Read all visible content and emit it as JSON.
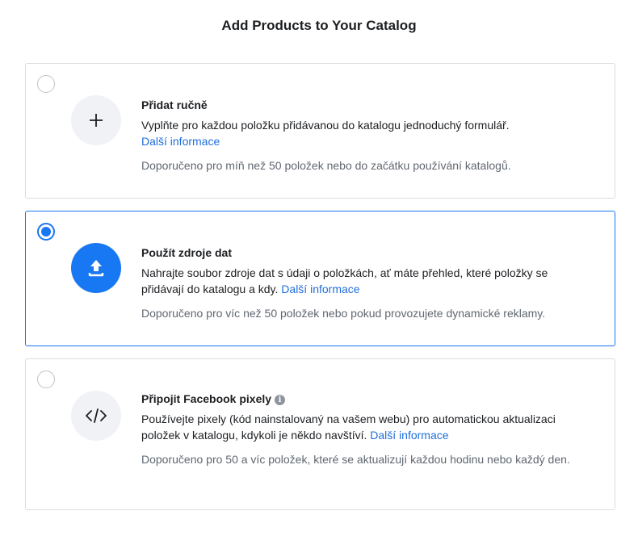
{
  "page": {
    "title": "Add Products to Your Catalog"
  },
  "colors": {
    "accent": "#1877f2",
    "link": "#216fdb",
    "muted": "#606770",
    "border": "#dadde1"
  },
  "options": [
    {
      "title": "Přidat ručně",
      "description": "Vyplňte pro každou položku přidávanou do katalogu jednoduchý formulář.",
      "link": "Další informace",
      "note": "Doporučeno pro míň než 50 položek nebo do začátku používání katalogů.",
      "icon": "plus-icon",
      "selected": false
    },
    {
      "title": "Použít zdroje dat",
      "description": "Nahrajte soubor zdroje dat s údaji o položkách, ať máte přehled, které položky se přidávají do katalogu a kdy.",
      "link": "Další informace",
      "note": "Doporučeno pro víc než 50 položek nebo pokud provozujete dynamické reklamy.",
      "icon": "upload-icon",
      "selected": true
    },
    {
      "title": "Připojit Facebook pixely",
      "info_icon": "info-icon",
      "description": "Používejte pixely (kód nainstalovaný na vašem webu) pro automatickou aktualizaci položek v katalogu, kdykoli je někdo navštíví.",
      "link": "Další informace",
      "note": "Doporučeno pro 50 a víc položek, které se aktualizují každou hodinu nebo každý den.",
      "icon": "code-icon",
      "selected": false
    }
  ]
}
